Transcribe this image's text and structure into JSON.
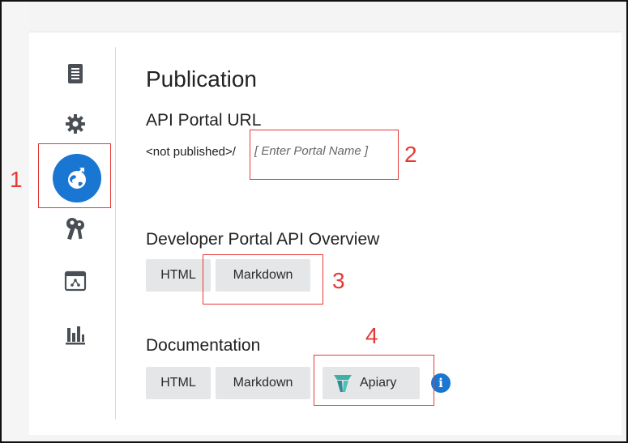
{
  "publication": {
    "title": "Publication",
    "api_portal_url": {
      "heading": "API Portal URL",
      "prefix": "<not published>/",
      "portal_name_placeholder": "[ Enter Portal Name ]"
    },
    "developer_portal_overview": {
      "heading": "Developer Portal API Overview",
      "buttons": [
        "HTML",
        "Markdown"
      ]
    },
    "documentation": {
      "heading": "Documentation",
      "buttons": [
        "HTML",
        "Markdown",
        "Apiary"
      ]
    }
  },
  "sidebar": {
    "icons": [
      "document-list-icon",
      "gear-icon",
      "globe-publish-icon",
      "keys-icon",
      "deploy-window-icon",
      "bar-chart-icon"
    ],
    "active": "globe-publish-icon"
  },
  "callouts": [
    "1",
    "2",
    "3",
    "4"
  ],
  "colors": {
    "accent": "#1976d2",
    "callout": "#e53935",
    "button_bg": "#e4e6e8"
  }
}
